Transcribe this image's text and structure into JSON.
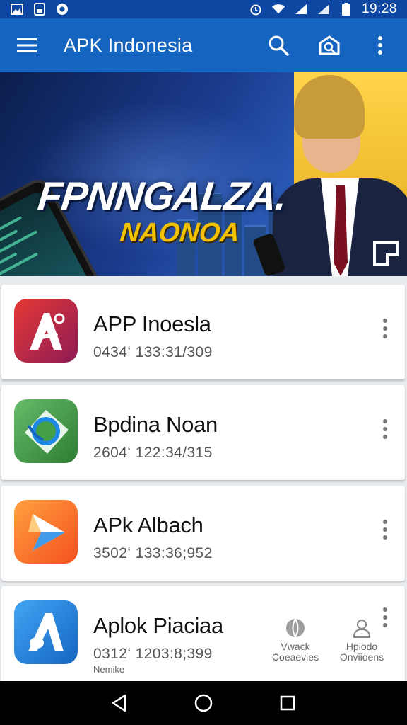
{
  "status_bar": {
    "time": "19:28",
    "left_icons": [
      "image-icon",
      "sim-icon",
      "circle-app-icon"
    ],
    "right_icons": [
      "alarm-icon",
      "wifi-icon",
      "signal-icon",
      "signal-icon",
      "battery-icon"
    ]
  },
  "app_bar": {
    "title": "APK Indonesia",
    "actions": [
      "search-icon",
      "scan-icon",
      "more-vert-icon"
    ],
    "background": "#1565c0"
  },
  "banner": {
    "title": "FPNNGALZA.",
    "subtitle": "NAONOA"
  },
  "apps": [
    {
      "name": "APP Inoesla",
      "meta": "0434ʻ 133:31/309",
      "icon": "a-logo-red-icon",
      "icon_colors": [
        "#e53935",
        "#8e1b55"
      ]
    },
    {
      "name": "Bpdina Noan",
      "meta": "2604ʻ 122:34/315",
      "icon": "green-target-icon",
      "icon_colors": [
        "#43a047",
        "#1e88e5"
      ]
    },
    {
      "name": "APk Albach",
      "meta": "3502ʻ 133:36;952",
      "icon": "play-arrow-orange-icon",
      "icon_colors": [
        "#ff7a1a",
        "#1e88e5"
      ]
    },
    {
      "name": "Aplok Piaciaa",
      "meta": "0312ʻ 1203:8;399",
      "meta_2": "Nemike",
      "icon": "a-logo-blue-icon",
      "icon_colors": [
        "#1e88e5",
        "#0d47a1"
      ],
      "mini_actions": [
        {
          "label_1": "Vwack",
          "label_2": "Coeaevies",
          "icon": "globe-icon"
        },
        {
          "label_1": "Hpiodo",
          "label_2": "Onviioens",
          "icon": "person-icon"
        }
      ]
    }
  ],
  "nav_bar": {
    "buttons": [
      "back-icon",
      "home-icon",
      "recents-icon"
    ]
  }
}
